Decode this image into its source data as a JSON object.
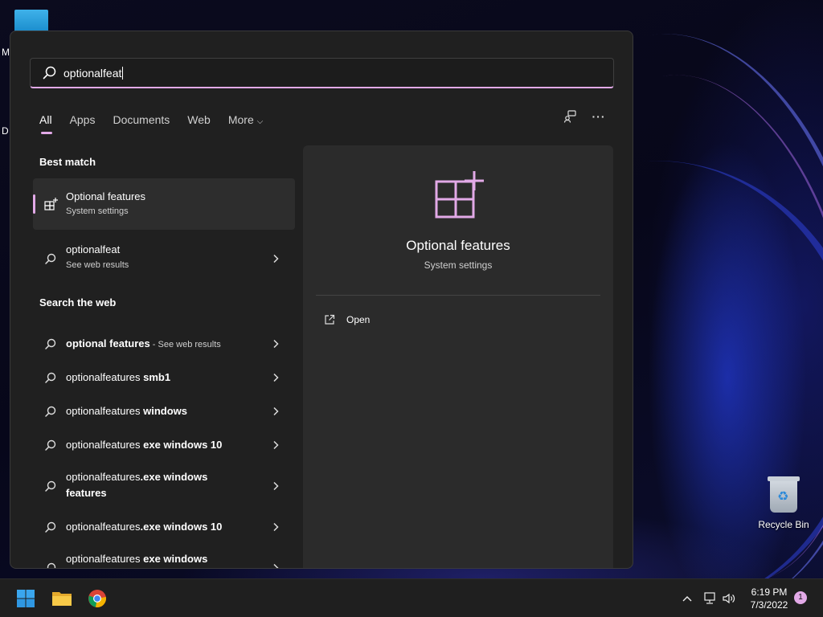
{
  "desktop": {
    "partial_labels": [
      "M",
      "D"
    ],
    "recycle_bin_label": "Recycle Bin"
  },
  "search": {
    "query": "optionalfeat"
  },
  "tabs": [
    {
      "label": "All",
      "active": true
    },
    {
      "label": "Apps",
      "active": false
    },
    {
      "label": "Documents",
      "active": false
    },
    {
      "label": "Web",
      "active": false
    },
    {
      "label": "More",
      "active": false,
      "has_dropdown": true
    }
  ],
  "header_buttons": [
    "share-icon",
    "more-options-icon"
  ],
  "sections": {
    "best_match": "Best match",
    "search_web": "Search the web"
  },
  "best_match": {
    "title": "Optional features",
    "subtitle": "System settings"
  },
  "web_top": {
    "title": "optionalfeat",
    "subtitle": "See web results"
  },
  "web_results": [
    {
      "bold": "optional features",
      "suffix": " - See web results"
    },
    {
      "normal": "optionalfeatures",
      "bold": " smb1"
    },
    {
      "normal": "optionalfeatures",
      "bold": " windows"
    },
    {
      "normal": "optionalfeatures",
      "bold": " exe windows 10"
    },
    {
      "normal": "optionalfeatures",
      "bold": ".exe windows features"
    },
    {
      "normal": "optionalfeatures",
      "bold": ".exe windows 10"
    },
    {
      "normal": "optionalfeatures",
      "bold": " exe windows features"
    }
  ],
  "details": {
    "title": "Optional features",
    "subtitle": "System settings",
    "action": "Open"
  },
  "taskbar": {
    "apps": [
      "start-icon",
      "file-explorer-icon",
      "chrome-icon"
    ],
    "clock_time": "6:19 PM",
    "clock_date": "7/3/2022",
    "notification_count": "1"
  },
  "colors": {
    "accent": "#e2a9e7",
    "panel_bg": "#202020",
    "details_bg": "#2b2b2b",
    "taskbar_bg": "#1f1f1f"
  }
}
